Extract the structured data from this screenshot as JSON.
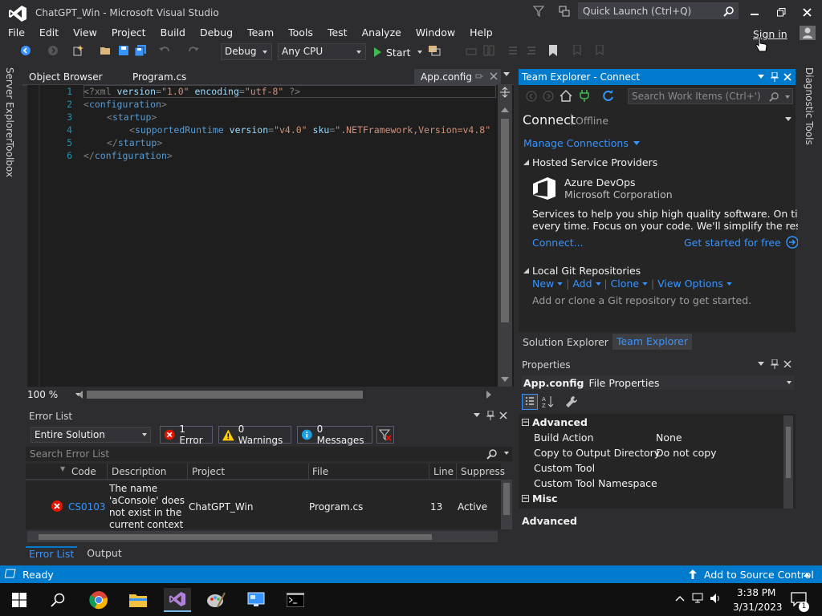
{
  "window": {
    "title": "ChatGPT_Win - Microsoft Visual Studio",
    "quick_launch_placeholder": "Quick Launch (Ctrl+Q)"
  },
  "menu": [
    "File",
    "Edit",
    "View",
    "Project",
    "Build",
    "Debug",
    "Team",
    "Tools",
    "Test",
    "Analyze",
    "Window",
    "Help"
  ],
  "account": {
    "sign_in": "Sign in"
  },
  "toolbar": {
    "configuration": "Debug",
    "platform": "Any CPU",
    "start_label": "Start"
  },
  "left_tabs": [
    "Server Explorer",
    "Toolbox"
  ],
  "right_tabs": [
    "Diagnostic Tools"
  ],
  "doc_tabs": [
    "Object Browser",
    "Program.cs",
    "App.config"
  ],
  "editor": {
    "line_numbers": [
      "1",
      "2",
      "3",
      "4",
      "5",
      "6"
    ],
    "lines": [
      [
        "<?xml ",
        "version",
        "=",
        "\"1.0\"",
        " ",
        "encoding",
        "=",
        "\"utf-8\"",
        " ?>"
      ],
      [
        "<",
        "configuration",
        ">"
      ],
      [
        "<",
        "startup",
        ">"
      ],
      [
        "<",
        "supportedRuntime",
        " ",
        "version",
        "=",
        "\"v4.0\"",
        " ",
        "sku",
        "=",
        "\".NETFramework,Version=v4.8\""
      ],
      [
        "</",
        "startup",
        ">"
      ],
      [
        "</",
        "configuration",
        ">"
      ]
    ],
    "zoom": "100 %"
  },
  "error_list": {
    "title": "Error List",
    "scope": "Entire Solution",
    "errors_btn": "1 Error",
    "warnings_btn": "0 Warnings",
    "messages_btn": "0 Messages",
    "search_placeholder": "Search Error List",
    "columns": [
      "Code",
      "Description",
      "Project",
      "File",
      "Line",
      "Suppress"
    ],
    "rows": [
      {
        "code": "CS0103",
        "description_lines": [
          "The name",
          "'aConsole' does",
          "not exist in the",
          "current context"
        ],
        "project": "ChatGPT_Win",
        "file": "Program.cs",
        "line": "13",
        "suppression": "Active"
      }
    ],
    "bottom_tabs": [
      "Error List",
      "Output"
    ]
  },
  "team_explorer": {
    "title": "Team Explorer - Connect",
    "search_placeholder": "Search Work Items (Ctrl+')",
    "heading": "Connect",
    "status": "Offline",
    "manage_connections": "Manage Connections",
    "hosted_section": "Hosted Service Providers",
    "provider_name": "Azure DevOps",
    "provider_company": "Microsoft Corporation",
    "provider_desc_1": "Services to help you ship high quality software. On time,",
    "provider_desc_2": "every time. Focus on your code. We'll simplify the rest.",
    "connect_link": "Connect...",
    "get_started": "Get started for free",
    "git_section": "Local Git Repositories",
    "git_links": [
      "New",
      "Add",
      "Clone",
      "View Options"
    ],
    "git_hint": "Add or clone a Git repository to get started.",
    "bottom_tabs": [
      "Solution Explorer",
      "Team Explorer"
    ]
  },
  "properties": {
    "title": "Properties",
    "object_name": "App.config",
    "object_type": "File Properties",
    "categories": [
      "Advanced",
      "Misc"
    ],
    "rows": [
      {
        "name": "Build Action",
        "value": "None"
      },
      {
        "name": "Copy to Output Directory",
        "value": "Do not copy"
      },
      {
        "name": "Custom Tool",
        "value": ""
      },
      {
        "name": "Custom Tool Namespace",
        "value": ""
      }
    ],
    "description_title": "Advanced"
  },
  "status_bar": {
    "state": "Ready",
    "source_control": "Add to Source Control"
  },
  "taskbar": {
    "time": "3:38 PM",
    "date": "3/31/2023",
    "notification_count": "1"
  },
  "colors": {
    "accent": "#007acc",
    "error": "#e51400",
    "warning": "#ffcc00",
    "link": "#3794ff"
  }
}
